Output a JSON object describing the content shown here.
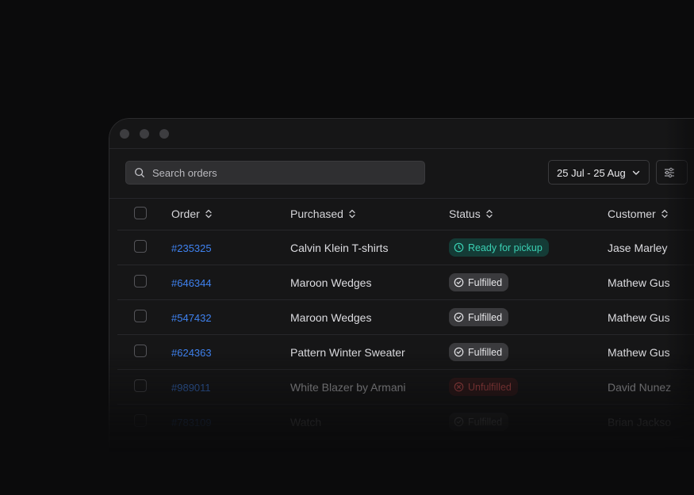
{
  "search": {
    "placeholder": "Search orders"
  },
  "date_range": {
    "label": "25 Jul - 25 Aug"
  },
  "columns": {
    "order": "Order",
    "purchased": "Purchased",
    "status": "Status",
    "customer": "Customer"
  },
  "rows": [
    {
      "order": "#235325",
      "purchased": "Calvin Klein T-shirts",
      "status": "Ready for pickup",
      "status_kind": "ready",
      "customer": "Jase Marley"
    },
    {
      "order": "#646344",
      "purchased": "Maroon Wedges",
      "status": "Fulfilled",
      "status_kind": "fulfilled",
      "customer": "Mathew Gus"
    },
    {
      "order": "#547432",
      "purchased": "Maroon Wedges",
      "status": "Fulfilled",
      "status_kind": "fulfilled",
      "customer": "Mathew Gus"
    },
    {
      "order": "#624363",
      "purchased": "Pattern Winter Sweater",
      "status": "Fulfilled",
      "status_kind": "fulfilled",
      "customer": "Mathew Gus"
    },
    {
      "order": "#989011",
      "purchased": "White Blazer by Armani",
      "status": "Unfulfilled",
      "status_kind": "unfulfilled",
      "customer": "David Nunez"
    },
    {
      "order": "#783109",
      "purchased": "Watch",
      "status": "Fulfilled",
      "status_kind": "fulfilled",
      "customer": "Brian Jackso"
    }
  ],
  "colors": {
    "link": "#3f82f0",
    "ready": "#3ad0b3",
    "unfulfilled": "#e45858"
  }
}
